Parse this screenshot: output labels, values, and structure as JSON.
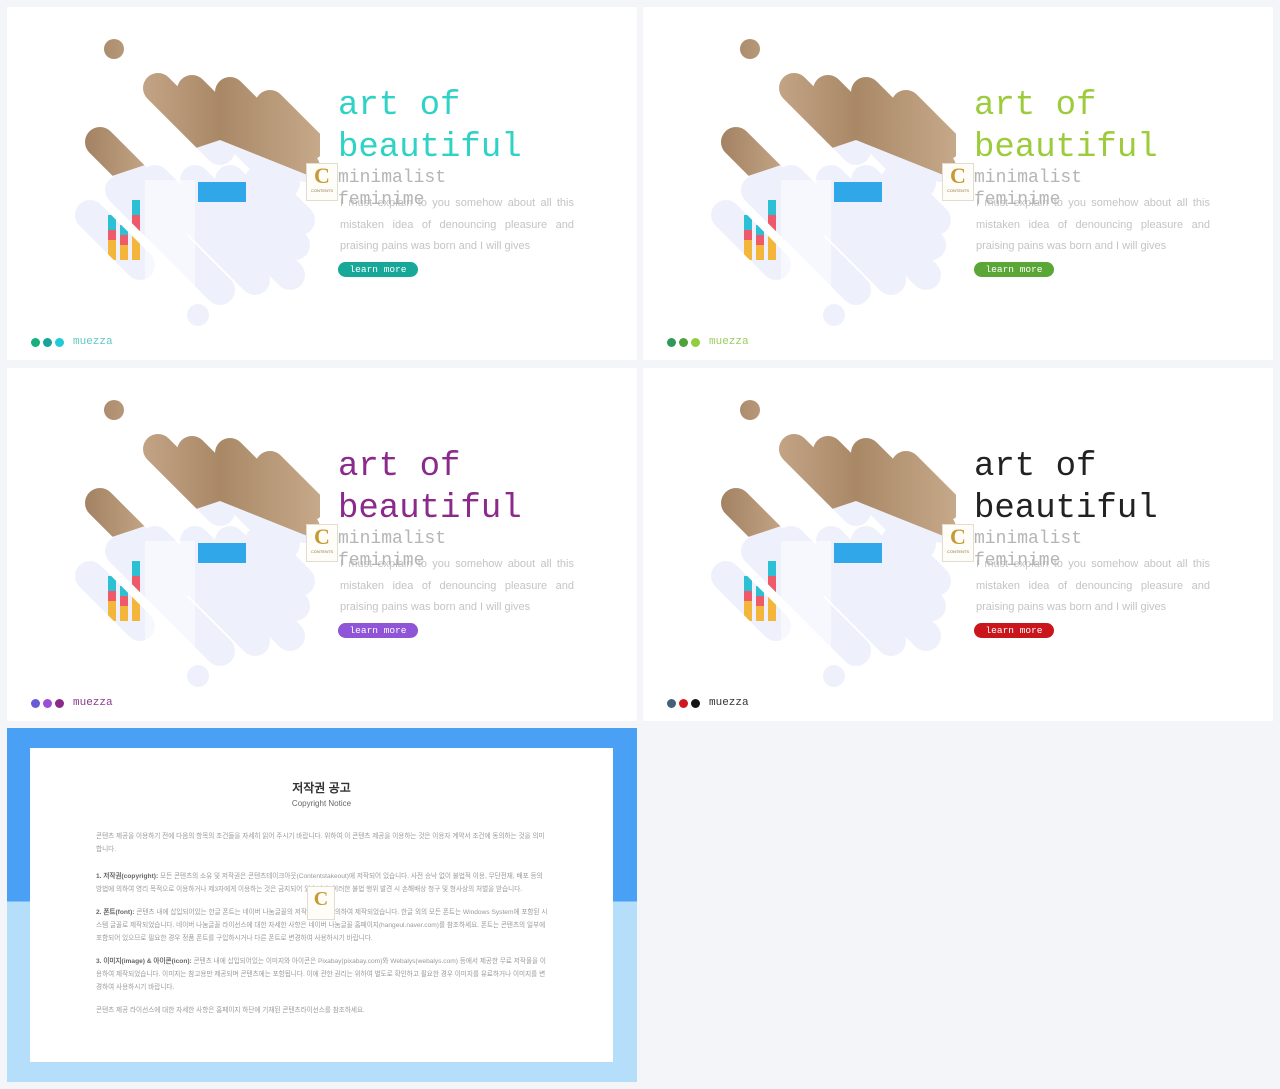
{
  "slides": [
    {
      "title_line1": "art of",
      "title_line2": "beautiful",
      "subtitle_line1": "minimalist",
      "subtitle_line2": "feminime",
      "body": [
        "I must explain to you somehow about all this",
        "mistaken idea of denouncing pleasure and",
        "praising pains was born and I will gives"
      ],
      "button_label": "learn more",
      "brand": "muezza",
      "accent": "#2ed3c6",
      "button_color": "#17a89a",
      "brand_color": "#5fc8c2",
      "dots": [
        "#16b07e",
        "#15a39a",
        "#22c9d6"
      ]
    },
    {
      "title_line1": "art of",
      "title_line2": "beautiful",
      "subtitle_line1": "minimalist",
      "subtitle_line2": "feminime",
      "body": [
        "I must explain to you somehow about all this",
        "mistaken idea of denouncing pleasure and",
        "praising pains was born and I will gives"
      ],
      "button_label": "learn more",
      "brand": "muezza",
      "accent": "#9ccc3c",
      "button_color": "#5aa637",
      "brand_color": "#9ccc5c",
      "dots": [
        "#2e9a5a",
        "#4fa23c",
        "#8fcf3c"
      ]
    },
    {
      "title_line1": "art of",
      "title_line2": "beautiful",
      "subtitle_line1": "minimalist",
      "subtitle_line2": "feminime",
      "body": [
        "I must explain to you somehow about all this",
        "mistaken idea of denouncing pleasure and",
        "praising pains was born and I will gives"
      ],
      "button_label": "learn more",
      "brand": "muezza",
      "accent": "#8b2a8c",
      "button_color": "#8f55d6",
      "brand_color": "#8b3a8c",
      "dots": [
        "#6a5ad8",
        "#9b4fd6",
        "#8c2a8c"
      ]
    },
    {
      "title_line1": "art of",
      "title_line2": "beautiful",
      "subtitle_line1": "minimalist",
      "subtitle_line2": "feminime",
      "body": [
        "I must explain to you somehow about all this",
        "mistaken idea of denouncing pleasure and",
        "praising pains was born and I will gives"
      ],
      "button_label": "learn more",
      "brand": "muezza",
      "accent": "#222222",
      "button_color": "#c8161c",
      "brand_color": "#333333",
      "dots": [
        "#44607a",
        "#d01820",
        "#151515"
      ]
    }
  ],
  "watermark_text": "CONTENTS",
  "copyright": {
    "title": "저작권 공고",
    "subtitle": "Copyright Notice",
    "intro": "콘텐츠 제공을 이용하기 전에 다음의 항목의 조건들을 자세히 읽어 주시기 바랍니다. 위하여 이 콘텐츠 제공을 이용하는 것은 이용자 계약서 조건에 동의하는 것을 의미합니다.",
    "sections": [
      {
        "heading": "1. 저작권(copyright):",
        "text": "모든 콘텐츠의 소유 및 저작권은 콘텐츠테이크아웃(Contentstakeout)에 저작되어 있습니다. 사전 승낙 없이 불법적 이용, 무단전재, 배포 등의 방법에 의하여 영리 목적으로 이용하거나 제3자에게 이용하는 것은 금지되어 있습니다. 이러한 불법 행위 발견 시 손해배상 청구 및 형사상의 처벌을 받습니다."
      },
      {
        "heading": "2. 폰트(font):",
        "text": "콘텐츠 내에 삽입되어있는 한글 폰트는 네이버 나눔글꼴의 저작권 표시에 의하여 제작되었습니다. 한글 외의 모든 폰트는 Windows System에 포함된 시스템 글꼴로 제작되었습니다. 네이버 나눔글꼴 라이선스에 대한 자세한 사항은 네이버 나눔글꼴 홈페이지(hangeul.naver.com)를 참조하세요. 폰트는 콘텐츠의 일부에 포함되어 있으므로 필요한 경우 정품 폰트를 구입하시거나 다른 폰트로 변경하여 사용하시기 바랍니다."
      },
      {
        "heading": "3. 이미지(image) & 아이콘(icon):",
        "text": "콘텐츠 내에 삽입되어있는 이미지와 아이콘은 Pixabay(pixabay.com)와 Webalys(webalys.com) 등에서 제공한 무료 저작물을 이용하여 제작되었습니다. 이미지는 참고용만 제공되며 콘텐츠에는 포함됩니다. 이에 관한 권리는 위하여 별도로 확인하고 필요한 경우 이미지를 유료하거나 이미지를 변경하여 사용하시기 바랍니다."
      }
    ],
    "outro": "콘텐츠 제공 라이선스에 대한 자세한 사항은 홈페이지 하단에 기재된 콘텐츠라이선스를 참조하세요."
  }
}
